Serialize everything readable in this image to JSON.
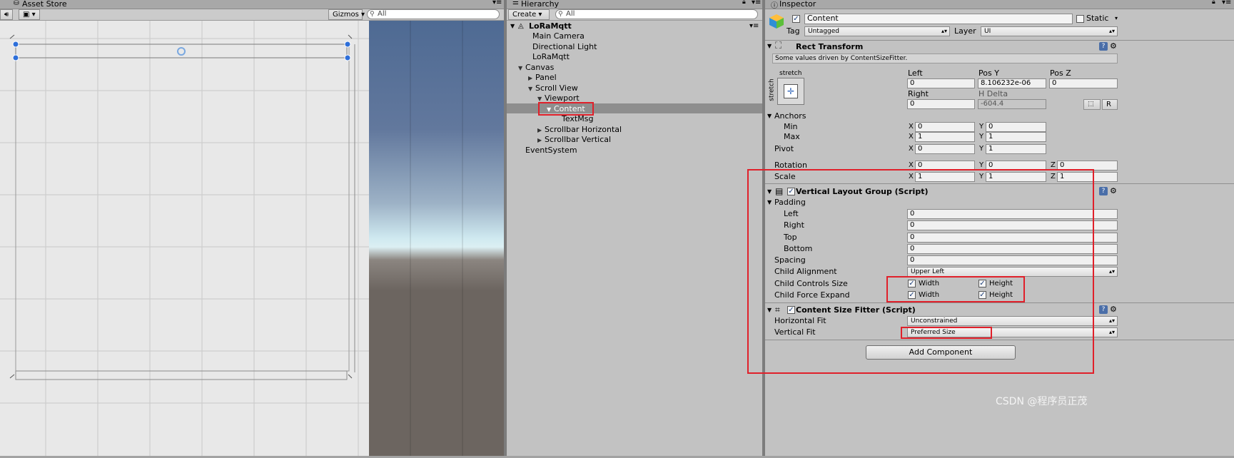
{
  "scene": {
    "tab_label": "Asset Store",
    "gizmos_label": "Gizmos",
    "search_placeholder": "All"
  },
  "hierarchy": {
    "tab_label": "Hierarchy",
    "create_label": "Create",
    "search_placeholder": "All",
    "root": "LoRaMqtt",
    "items": [
      {
        "label": "Main Camera",
        "arrow": ""
      },
      {
        "label": "Directional Light",
        "arrow": ""
      },
      {
        "label": "LoRaMqtt",
        "arrow": ""
      },
      {
        "label": "Canvas",
        "arrow": "▼"
      },
      {
        "label": "Panel",
        "arrow": "▶"
      },
      {
        "label": "Scroll View",
        "arrow": "▼"
      },
      {
        "label": "Viewport",
        "arrow": "▼"
      },
      {
        "label": "Content",
        "arrow": "▼"
      },
      {
        "label": "TextMsg",
        "arrow": ""
      },
      {
        "label": "Scrollbar Horizontal",
        "arrow": "▶"
      },
      {
        "label": "Scrollbar Vertical",
        "arrow": "▶"
      },
      {
        "label": "EventSystem",
        "arrow": ""
      }
    ]
  },
  "inspector": {
    "tab_label": "Inspector",
    "object_name": "Content",
    "static_label": "Static",
    "tag_label": "Tag",
    "tag_value": "Untagged",
    "layer_label": "Layer",
    "layer_value": "UI",
    "rect_transform": {
      "title": "Rect Transform",
      "note": "Some values driven by ContentSizeFitter.",
      "anchor_preset_top": "stretch",
      "anchor_preset_side": "stretch",
      "col_left": "Left",
      "col_posy": "Pos Y",
      "col_posz": "Pos Z",
      "left": "0",
      "posy": "8.106232e-06",
      "posz": "0",
      "col_right": "Right",
      "col_hdelta": "H Delta",
      "right": "0",
      "hdelta": "-604.4",
      "r_button": "R",
      "anchors_label": "Anchors",
      "min_label": "Min",
      "min_x": "0",
      "min_y": "0",
      "max_label": "Max",
      "max_x": "1",
      "max_y": "1",
      "pivot_label": "Pivot",
      "pivot_x": "0",
      "pivot_y": "1",
      "rotation_label": "Rotation",
      "rot_x": "0",
      "rot_y": "0",
      "rot_z": "0",
      "scale_label": "Scale",
      "scale_x": "1",
      "scale_y": "1",
      "scale_z": "1",
      "x": "X",
      "y": "Y",
      "z": "Z"
    },
    "vlg": {
      "title": "Vertical Layout Group (Script)",
      "padding_label": "Padding",
      "left_label": "Left",
      "left": "0",
      "right_label": "Right",
      "right": "0",
      "top_label": "Top",
      "top": "0",
      "bottom_label": "Bottom",
      "bottom": "0",
      "spacing_label": "Spacing",
      "spacing": "0",
      "child_alignment_label": "Child Alignment",
      "child_alignment": "Upper Left",
      "controls_label": "Child Controls Size",
      "expand_label": "Child Force Expand",
      "width_label": "Width",
      "height_label": "Height"
    },
    "csf": {
      "title": "Content Size Fitter (Script)",
      "hfit_label": "Horizontal Fit",
      "hfit": "Unconstrained",
      "vfit_label": "Vertical Fit",
      "vfit": "Preferred Size"
    },
    "add_component": "Add Component"
  },
  "watermark": "CSDN @程序员正茂",
  "colors": {
    "highlight": "#e0202a",
    "selection": "#8e8e8e",
    "sky_top": "#4e6a93",
    "horizon": "#cfe9f0",
    "ground": "#6c6560"
  }
}
